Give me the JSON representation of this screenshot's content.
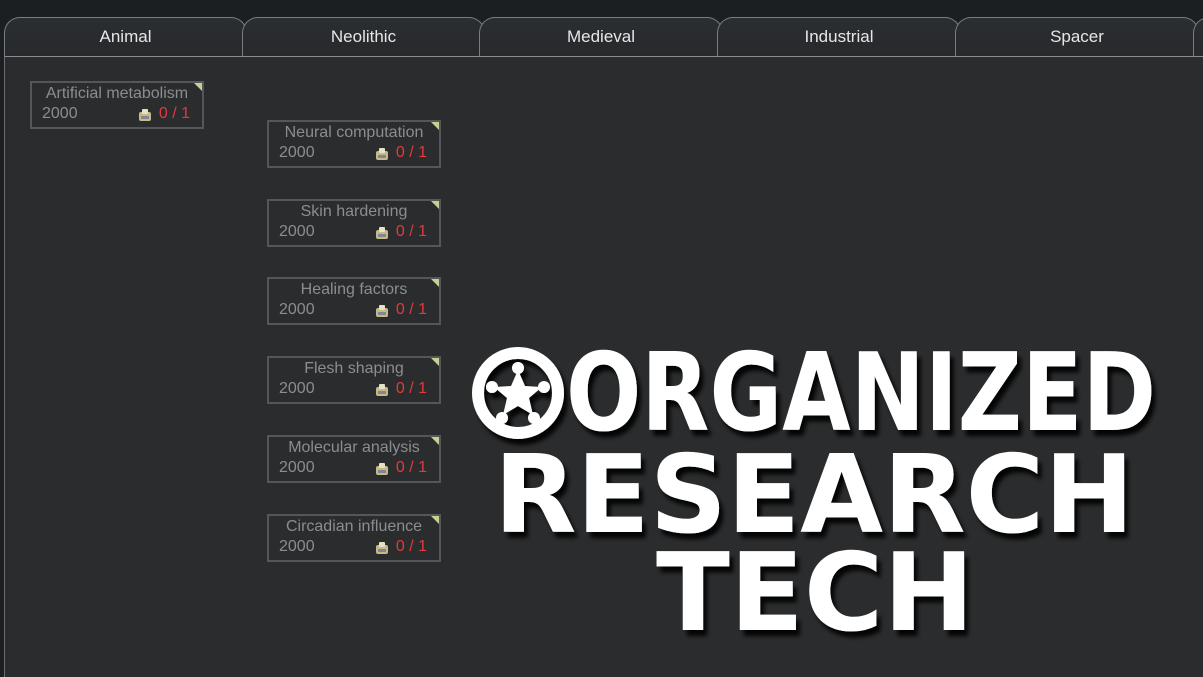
{
  "tabs": [
    {
      "label": "Animal"
    },
    {
      "label": "Neolithic"
    },
    {
      "label": "Medieval"
    },
    {
      "label": "Industrial"
    },
    {
      "label": "Spacer"
    },
    {
      "label": ""
    }
  ],
  "projects": [
    {
      "title": "Artificial metabolism",
      "cost": "2000",
      "progress": "0 / 1"
    },
    {
      "title": "Neural computation",
      "cost": "2000",
      "progress": "0 / 1"
    },
    {
      "title": "Skin hardening",
      "cost": "2000",
      "progress": "0 / 1"
    },
    {
      "title": "Healing factors",
      "cost": "2000",
      "progress": "0 / 1"
    },
    {
      "title": "Flesh shaping",
      "cost": "2000",
      "progress": "0 / 1"
    },
    {
      "title": "Molecular analysis",
      "cost": "2000",
      "progress": "0 / 1"
    },
    {
      "title": "Circadian influence",
      "cost": "2000",
      "progress": "0 / 1"
    }
  ],
  "logo": {
    "line1": "ORGANIZED",
    "line2": "RESEARCH",
    "line3": "TECH",
    "icon": "star-ring-icon"
  },
  "colors": {
    "progress_red": "#e23a3a",
    "card_corner": "#c9cf94",
    "panel_bg": "#2a2c2e"
  }
}
